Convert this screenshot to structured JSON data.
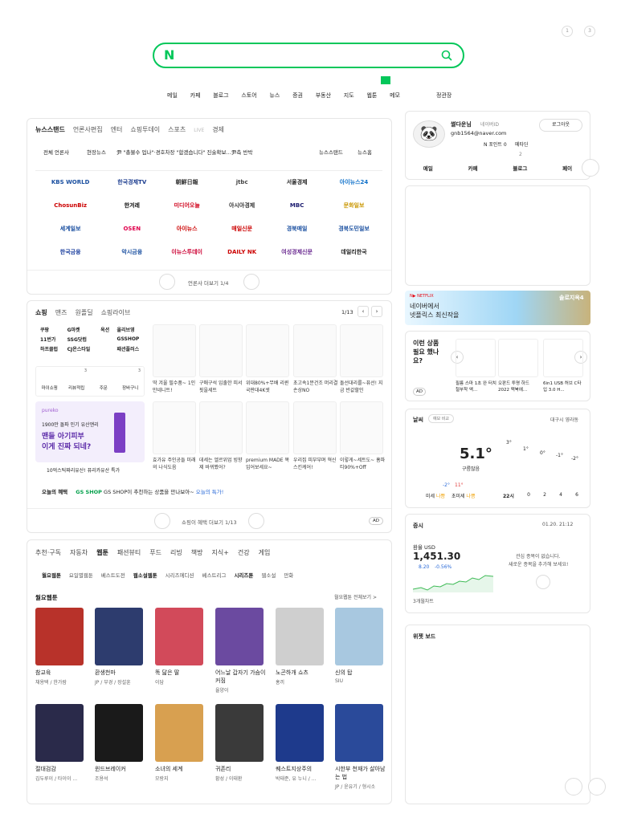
{
  "top": {
    "notif1": "1",
    "notif2": "3"
  },
  "search": {
    "logo": "N",
    "placeholder": ""
  },
  "nav": [
    "메일",
    "카페",
    "블로그",
    "스토어",
    "뉴스",
    "증권",
    "부동산",
    "지도",
    "웹툰",
    "메모"
  ],
  "nav_extra": "정관장",
  "news": {
    "tabs": [
      "뉴스스탠드",
      "언론사편집",
      "엔터",
      "쇼핑투데이",
      "스포츠",
      "LIVE",
      "경제"
    ],
    "sub_left": "전체 언론사",
    "sub_mid": "현장뉴스",
    "headline": "尹 \"총불수 업나\"·경호차장 \"합겠습니다\" 진술확보…尹측 반박",
    "sub_right1": "뉴스스탠드",
    "sub_right2": "뉴스홈",
    "press": [
      [
        "KBS WORLD",
        "한국경제TV",
        "朝鮮日報",
        "jtbc",
        "서울경제",
        "아이뉴스24"
      ],
      [
        "ChosunBiz",
        "한겨레",
        "미디어오늘",
        "아시아경제",
        "MBC",
        "문화일보"
      ],
      [
        "세계일보",
        "OSEN",
        "아이뉴스",
        "매일신문",
        "경북매일",
        "경북도민일보"
      ],
      [
        "한국금융",
        "악시금융",
        "이뉴스투데이",
        "DAILY NK",
        "여성경제신문",
        "데일리한국"
      ]
    ],
    "more": "언론사 더보기 1/4"
  },
  "shop": {
    "tabs": [
      "쇼핑",
      "맨즈",
      "원플딜",
      "쇼핑라이브"
    ],
    "page": "1/13",
    "grid": [
      [
        "쿠팡",
        "G마켓",
        "옥션",
        "올리브영"
      ],
      [
        "11번가",
        "SSG닷컴",
        "",
        "GSSHOP"
      ],
      [
        "하프클럽",
        "CJ온스타일",
        "",
        "패션플러스"
      ]
    ],
    "icons": [
      {
        "label": "마이쇼핑",
        "badge": ""
      },
      {
        "label": "리뷰적립",
        "badge": "3"
      },
      {
        "label": "주문",
        "badge": ""
      },
      {
        "label": "장바구니",
        "badge": "3"
      }
    ],
    "ad_brand": "pureko",
    "ad_sub": "1900만 돌파 인기 유산앤리",
    "ad_t1": "맨들 아기피부",
    "ad_t2": "이게 진짜 되네?",
    "ad_caption": "10억스틱짜리유산! 퓨리카유산 특가",
    "row1": [
      "딱 겨울 필수품~ 1인만네니트!",
      "구매구석 입출한 피서 핏을세트",
      "위대80%+무배 리퀸국판대4K셋",
      "초고속1분건조 머리결 손상NO",
      "돌선대리를~퓨선! 지금 반값할인"
    ],
    "row2": [
      "효가유 주인공들 미래의 나식도음",
      "데세는 엘르위업 빙향제 바뀌봤어?",
      "premium MADE 목 입어보세요~",
      "우리집 피부부며 혁신 스킨케어!",
      "이렇게~세트도~ 홈파티90%+Off"
    ],
    "benefit_label": "오늘의 혜택",
    "benefit_brand": "GS SHOP",
    "benefit_text": "GS SHOP이 추천하는 상품을 만나보아~",
    "benefit_link": "오늘의 특가!",
    "more": "쇼핑이 혜택 더보기 1/13",
    "ad": "AD"
  },
  "webtoon": {
    "cats": [
      "추천·구독",
      "자동차",
      "웹툰",
      "패션뷰티",
      "푸드",
      "리빙",
      "책방",
      "지식+",
      "건강",
      "게임"
    ],
    "subtabs": [
      "월요웹툰",
      "요일별웹툰",
      "베스트도전",
      "웹소설웹툰",
      "시리즈에디션",
      "베스트리그",
      "시리즈툰",
      "웹소설",
      "만화"
    ],
    "section": "월요웹툰",
    "section_more": "월요웹툰 전체보기 >",
    "items": [
      {
        "title": "참교육",
        "author": "채용택 / 한가람"
      },
      {
        "title": "환생천마",
        "author": "JP / 부경 / 장설훈"
      },
      {
        "title": "똑 닮은 딸",
        "author": "이담"
      },
      {
        "title": "어느날 갑자기 가슴이 커짐",
        "author": "율양이"
      },
      {
        "title": "노곤하개 쇼츠",
        "author": "홍끼"
      },
      {
        "title": "신의 탑",
        "author": "SIU"
      },
      {
        "title": "절대검감",
        "author": "김두루이 / 타이이 ..."
      },
      {
        "title": "윈드브레이커",
        "author": "조용석"
      },
      {
        "title": "소녀의 세계",
        "author": "모랑지"
      },
      {
        "title": "귀존리",
        "author": "황성 / 이태환"
      },
      {
        "title": "퀘스트지상주의",
        "author": "박태준, 유 누니 / ..."
      },
      {
        "title": "시한부 천재가 살아남는 법",
        "author": "JP / 윤유기 / 형시소"
      }
    ]
  },
  "user": {
    "name": "썰다운님",
    "sub": "네이버ID",
    "email": "gnb1564@naver.com",
    "logout": "로그아웃",
    "pay": "N 포인트 0",
    "pay2": "메타딘",
    "count": "2",
    "links": [
      "메일",
      "카페",
      "블로그",
      "페이"
    ]
  },
  "banner": {
    "tag": "N▶ NETFLIX",
    "line1": "네이버에서",
    "line2": "넷플릭스 최신작을",
    "show": "솔로지옥4"
  },
  "rec": {
    "title": "이런 상품 필요 했나요?",
    "ad": "AD",
    "items": [
      "필름 스마 1초 완 터치 철부착 액...",
      "오판드 투명 하드 2022 맥북에...",
      "6in1 USB 허브 C타입 3.0 H..."
    ]
  },
  "weather": {
    "title": "날씨",
    "pill": "예보 비교",
    "location": "대구시 영라동",
    "temp": "5.1°",
    "cond": "구름많음",
    "hours": [
      "22시",
      "0",
      "2",
      "4",
      "6"
    ],
    "vals": [
      "3°",
      "1°",
      "0°",
      "-1°",
      "-2°"
    ],
    "lo": "-2°",
    "hi": "11°",
    "dust1": "미세",
    "dust1v": "나쁨",
    "dust2": "초미세",
    "dust2v": "나쁨"
  },
  "stock": {
    "title": "증시",
    "time": "01.20. 21:12",
    "label": "환율 USD",
    "value": "1,451.30",
    "change": "8.20",
    "pct": "-0.56%",
    "period": "3개월차트",
    "empty1": "관심 종목이 없습니다.",
    "empty2": "새로운 종목을 추가해 보세요!"
  },
  "widget": {
    "title": "위젯 보드"
  }
}
